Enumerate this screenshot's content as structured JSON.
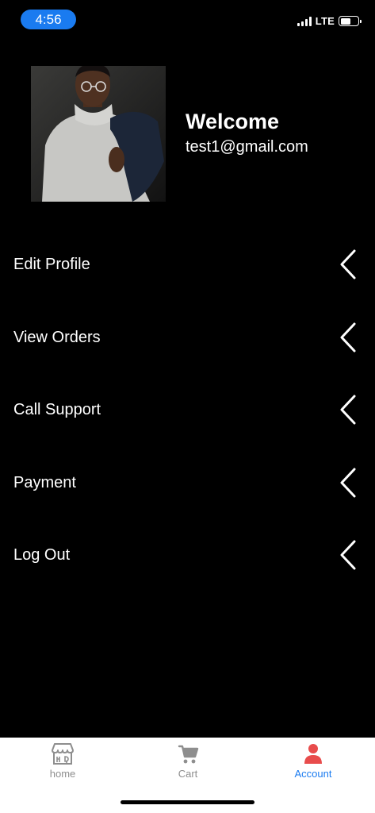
{
  "status_bar": {
    "time": "4:56",
    "network": "LTE",
    "battery_level": 0.5
  },
  "profile": {
    "welcome": "Welcome",
    "email": "test1@gmail.com"
  },
  "menu": {
    "items": [
      {
        "label": "Edit Profile"
      },
      {
        "label": "View Orders"
      },
      {
        "label": "Call Support"
      },
      {
        "label": "Payment"
      },
      {
        "label": "Log Out"
      }
    ]
  },
  "tab_bar": {
    "tabs": [
      {
        "label": "home",
        "icon": "storefront-icon",
        "active": false
      },
      {
        "label": "Cart",
        "icon": "cart-icon",
        "active": false
      },
      {
        "label": "Account",
        "icon": "person-icon",
        "active": true
      }
    ],
    "colors": {
      "active": "#1a7bf0",
      "inactive": "#8e8e8e",
      "account_icon": "#e84c4c"
    }
  }
}
